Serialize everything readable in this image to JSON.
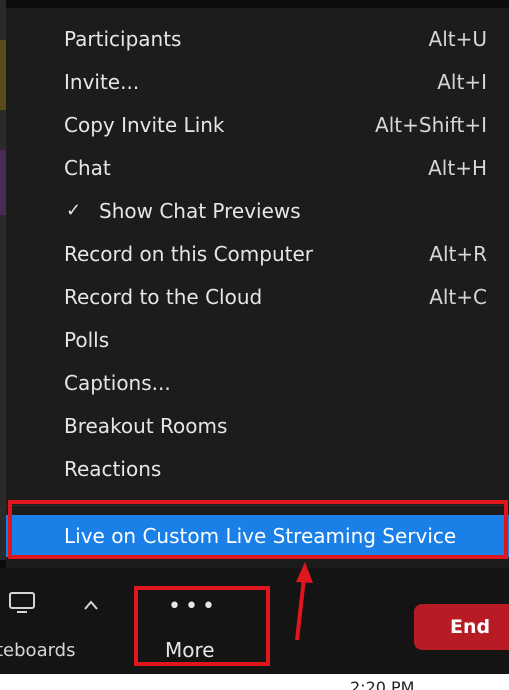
{
  "menu": {
    "items": [
      {
        "label": "Participants",
        "shortcut": "Alt+U"
      },
      {
        "label": "Invite...",
        "shortcut": "Alt+I"
      },
      {
        "label": "Copy Invite Link",
        "shortcut": "Alt+Shift+I"
      },
      {
        "label": "Chat",
        "shortcut": "Alt+H"
      },
      {
        "label": "Show Chat Previews",
        "shortcut": "",
        "checked": true
      },
      {
        "label": "Record on this Computer",
        "shortcut": "Alt+R"
      },
      {
        "label": "Record to the Cloud",
        "shortcut": "Alt+C"
      },
      {
        "label": "Polls",
        "shortcut": ""
      },
      {
        "label": "Captions...",
        "shortcut": ""
      },
      {
        "label": "Breakout Rooms",
        "shortcut": ""
      },
      {
        "label": "Reactions",
        "shortcut": ""
      }
    ],
    "highlighted_item": {
      "label": "Live on Custom Live Streaming Service"
    },
    "check_glyph": "✓"
  },
  "toolbar": {
    "whiteboards_label": "teboards",
    "more_dots": "•••",
    "more_label": "More",
    "end_label": "End"
  },
  "taskbar": {
    "clock": "2:20 PM"
  },
  "colors": {
    "menu_bg": "#1c1c1c",
    "highlight": "#1a7fe6",
    "annotation_red": "#e0161e",
    "end_button": "#b71c24"
  },
  "icons": [
    "monitor-icon",
    "chevron-up-icon",
    "more-dots-icon",
    "checkmark-icon"
  ]
}
